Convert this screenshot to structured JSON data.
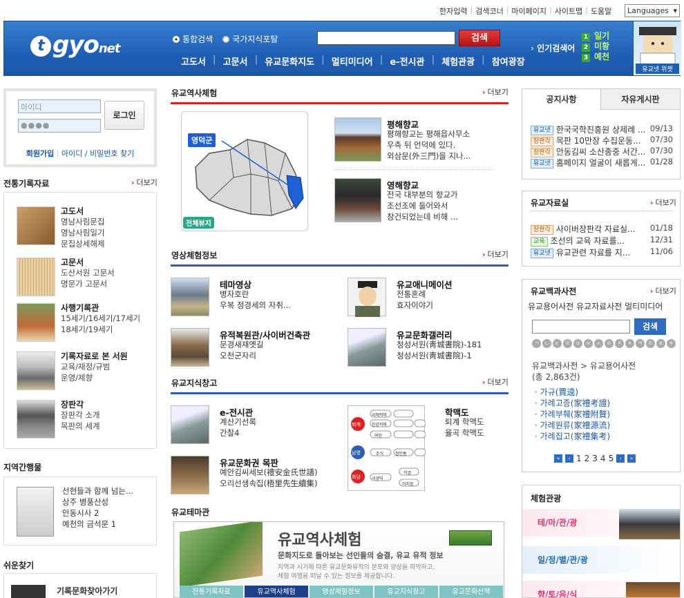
{
  "util": {
    "links": [
      "한자입력",
      "검색코너",
      "마이페이지",
      "사이트맵",
      "도움말"
    ],
    "languages": "Languages"
  },
  "header": {
    "logo": "gyo",
    "logo_suffix": "net",
    "radio1": "통합검색",
    "radio2": "국가지식포탈",
    "search_btn": "검색",
    "gnb": [
      "고도서",
      "고문서",
      "유교문화지도",
      "멀티미디어",
      "e-전시관",
      "체험관광",
      "참여광장"
    ],
    "hot_label": "인기검색어",
    "hot": [
      "일기",
      "미황",
      "예천"
    ],
    "widget": "유교넷 위젯"
  },
  "login": {
    "id_ph": "아이디",
    "pw_ph": "●●●●",
    "btn": "로그인",
    "join": "회원가입",
    "find": "아이디 / 비밀번호 찾기"
  },
  "left": {
    "sec1": "전통기록자료",
    "more": "더보기",
    "items": [
      {
        "t": "고도서",
        "s": [
          "영남사림문집",
          "영남사림일기",
          "문집상세해제"
        ]
      },
      {
        "t": "고문서",
        "s": [
          "도산서원 고문서",
          "명문가 고문서"
        ]
      },
      {
        "t": "사행기록관",
        "s": [
          "15세기/16세기/17세기",
          "18세기/19세기"
        ]
      },
      {
        "t": "기록자료로 본 서원",
        "s": [
          "교육/재정/규범",
          "운영/제향"
        ]
      },
      {
        "t": "장판각",
        "s": [
          "장판각 소개",
          "목판의 세계"
        ]
      }
    ],
    "sec2": "지역간행물",
    "reg": [
      "선현들과 함께 넘는...",
      "상주 병풍산성",
      "안동시사 2",
      "예천의 금석문 1"
    ],
    "sec3": "쉬운찾기",
    "easy": "기록문화찾아가기"
  },
  "center": {
    "s1": "유교역사체험",
    "s2": "영상체험정보",
    "s3": "유교지식창고",
    "s4": "유교테마관",
    "map_region": "영덕군",
    "map_btn": "전체뷰지",
    "hist": [
      {
        "t": "평해향교",
        "s": [
          "평해향교는 평해읍사무소",
          "우측 뒤 언덕에 있다.",
          "외삼문(外三門)을 지나..."
        ]
      },
      {
        "t": "영해향교",
        "s": [
          "전국 대부분의 향교가",
          "조선조에 들어와서",
          "창건되었는데 비해 ..."
        ]
      }
    ],
    "video": [
      {
        "t": "테마영상",
        "s": [
          "병자호란",
          "우복 정경세의 자취..."
        ]
      },
      {
        "t": "유교애니메이션",
        "s": [
          "전통혼례",
          "효자이야기"
        ]
      },
      {
        "t": "유적복원관/사이버건축관",
        "s": [
          "문경새재옛길",
          "오천군자리"
        ]
      },
      {
        "t": "유교문화갤러리",
        "s": [
          "청성서원(靑城書院)-181",
          "청성서원(靑城書院)-1"
        ]
      }
    ],
    "know": [
      {
        "t": "e-전시관",
        "s": [
          "계산기선록",
          "간찰4"
        ]
      },
      {
        "t": "유교문화권 목판",
        "s": [
          "예안김씨세보(禮安金氏世譜)",
          "오리선생속집(梧里先生續集)"
        ]
      },
      {
        "t": "학맥도",
        "s": [
          "퇴계 학맥도",
          "율곡 학맥도"
        ]
      }
    ],
    "diagram": [
      "퇴계",
      "남명",
      "화담",
      "서애학파",
      "한강학파",
      "여헌",
      "조식",
      "정인홍",
      "서경덕",
      "허엽",
      "이지함"
    ],
    "theme_title": "유교역사체험",
    "theme_sub": "문화지도로 돌아보는 선인들의 숨결, 유교 유적 정보",
    "theme_desc": [
      "지역과 시기에 따른 유교문화유적의 분포와 양상을 파악하고,",
      "체험 여행을 떠날 수 있는 정보를 제공합니다."
    ],
    "theme_tabs": [
      "전통기록자료",
      "유교역사체험",
      "영상체험정보",
      "유교지식창고",
      "유교문화산책"
    ]
  },
  "right": {
    "tabs": [
      "공지사항",
      "자유게시판"
    ],
    "notices": [
      {
        "b": "유교넷",
        "c": "b-blue",
        "t": "한국국학진흥원 상제례 ...",
        "d": "09/13"
      },
      {
        "b": "장판각",
        "c": "b-org",
        "t": "목판 10만장 수집운동...",
        "d": "07/30"
      },
      {
        "b": "장판각",
        "c": "b-org",
        "t": "안동김씨 소산종중 서간...",
        "d": "07/30"
      },
      {
        "b": "유교넷",
        "c": "b-blue",
        "t": "홈페이지 얼굴이 새롭게...",
        "d": "01/28"
      }
    ],
    "data_title": "유교자료실",
    "more": "더보기",
    "data": [
      {
        "b": "장판각",
        "c": "b-org",
        "t": "사이버장판각 자료실...",
        "d": "01/18"
      },
      {
        "b": "교육",
        "c": "b-grn",
        "t": "조선의 교육 자료를...",
        "d": "12/31"
      },
      {
        "b": "유교넷",
        "c": "b-blue",
        "t": "유교관련 자료를 지...",
        "d": "11/06"
      }
    ],
    "dict_title": "유교백과사전",
    "dict_tabs": "유교용어사전 유교자료사전 멀티미디어",
    "dict_btn": "검색",
    "chosung": [
      "ㄱ",
      "ㄴ",
      "ㄷ",
      "ㄹ",
      "ㅁ",
      "ㅂ",
      "ㅅ",
      "ㅇ",
      "ㅈ",
      "ㅊ",
      "ㅋ",
      "ㅌ",
      "ㅍ",
      "ㅎ"
    ],
    "crumb": "유교백과사전 > 유교용어사전",
    "count": "(총 2,863건)",
    "terms": [
      "가규(賈逵)",
      "가례고증(家禮考證)",
      "가례부췌(家禮附贅)",
      "가례원류(家禮源流)",
      "가례집고(家禮集考)"
    ],
    "pages": [
      "1",
      "2",
      "3",
      "4",
      "5"
    ],
    "exp_title": "체험관광",
    "exp": [
      "테/마/관/광",
      "일/정/별/관/광",
      "향/토/음/식"
    ]
  }
}
